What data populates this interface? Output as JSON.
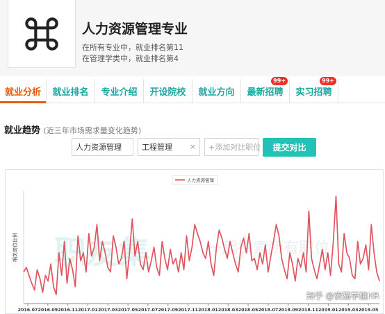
{
  "header": {
    "title": "人力资源管理专业",
    "rank_all": "在所有专业中，就业排名第11",
    "rank_category": "在管理学类中，就业排名第4",
    "logo_icon": "command-icon"
  },
  "tabs": [
    {
      "label": "就业分析",
      "active": true
    },
    {
      "label": "就业排名"
    },
    {
      "label": "专业介绍"
    },
    {
      "label": "开设院校"
    },
    {
      "label": "就业方向"
    },
    {
      "label": "最新招聘",
      "badge": "99+"
    },
    {
      "label": "实习招聘",
      "badge": "99+"
    }
  ],
  "section": {
    "title": "就业趋势",
    "subtitle": "(近三年市场需求量变化趋势)"
  },
  "compare": {
    "item1": "人力资源管理",
    "item2": "工程管理",
    "remove_symbol": "×",
    "placeholder": "+添加对比职位",
    "submit": "提交对比"
  },
  "watermark": "知乎 @夜猫学姐HR",
  "colors": {
    "accent_orange": "#e65a0a",
    "tab_teal": "#1aa7a0",
    "button_teal": "#22c2b7",
    "badge_red": "#e8332a",
    "line_red": "#e05560"
  },
  "chart_data": {
    "type": "line",
    "legend": "人力资源管理",
    "legend_position": "top-center",
    "ylabel": "相关岗位比例",
    "grid": false,
    "x_ticks": [
      "2016.07",
      "2016.09",
      "2016.11",
      "2017.01",
      "2017.03",
      "2017.05",
      "2017.07",
      "2017.09",
      "2017.11",
      "2018.01",
      "2018.03",
      "2018.05",
      "2018.07",
      "2018.09",
      "2018.11",
      "2019.01",
      "2019.03",
      "2019.05"
    ],
    "ylim": [
      0,
      100
    ],
    "series": [
      {
        "name": "人力资源管理",
        "values": [
          28,
          32,
          25,
          18,
          12,
          30,
          22,
          10,
          25,
          20,
          35,
          15,
          8,
          45,
          25,
          55,
          18,
          40,
          30,
          15,
          60,
          38,
          45,
          28,
          62,
          42,
          50,
          70,
          38,
          55,
          45,
          32,
          28,
          60,
          50,
          35,
          40,
          55,
          22,
          45,
          75,
          42,
          55,
          35,
          30,
          45,
          28,
          38,
          50,
          32,
          25,
          55,
          40,
          30,
          48,
          35,
          40,
          28,
          45,
          30,
          60,
          38,
          50,
          70,
          62,
          55,
          45,
          40,
          55,
          35,
          25,
          50,
          65,
          58,
          48,
          40,
          55,
          45,
          35,
          28,
          50,
          58,
          45,
          62,
          38,
          40,
          30,
          45,
          35,
          52,
          28,
          42,
          55,
          70,
          60,
          40,
          30,
          22,
          45,
          35,
          20,
          40,
          32,
          45,
          28,
          82,
          40,
          30,
          22,
          35,
          48,
          30,
          45,
          25,
          55,
          95,
          35,
          28,
          62,
          45,
          40,
          25,
          22,
          55,
          35,
          40,
          52,
          30,
          70,
          45,
          28,
          20
        ]
      }
    ]
  }
}
